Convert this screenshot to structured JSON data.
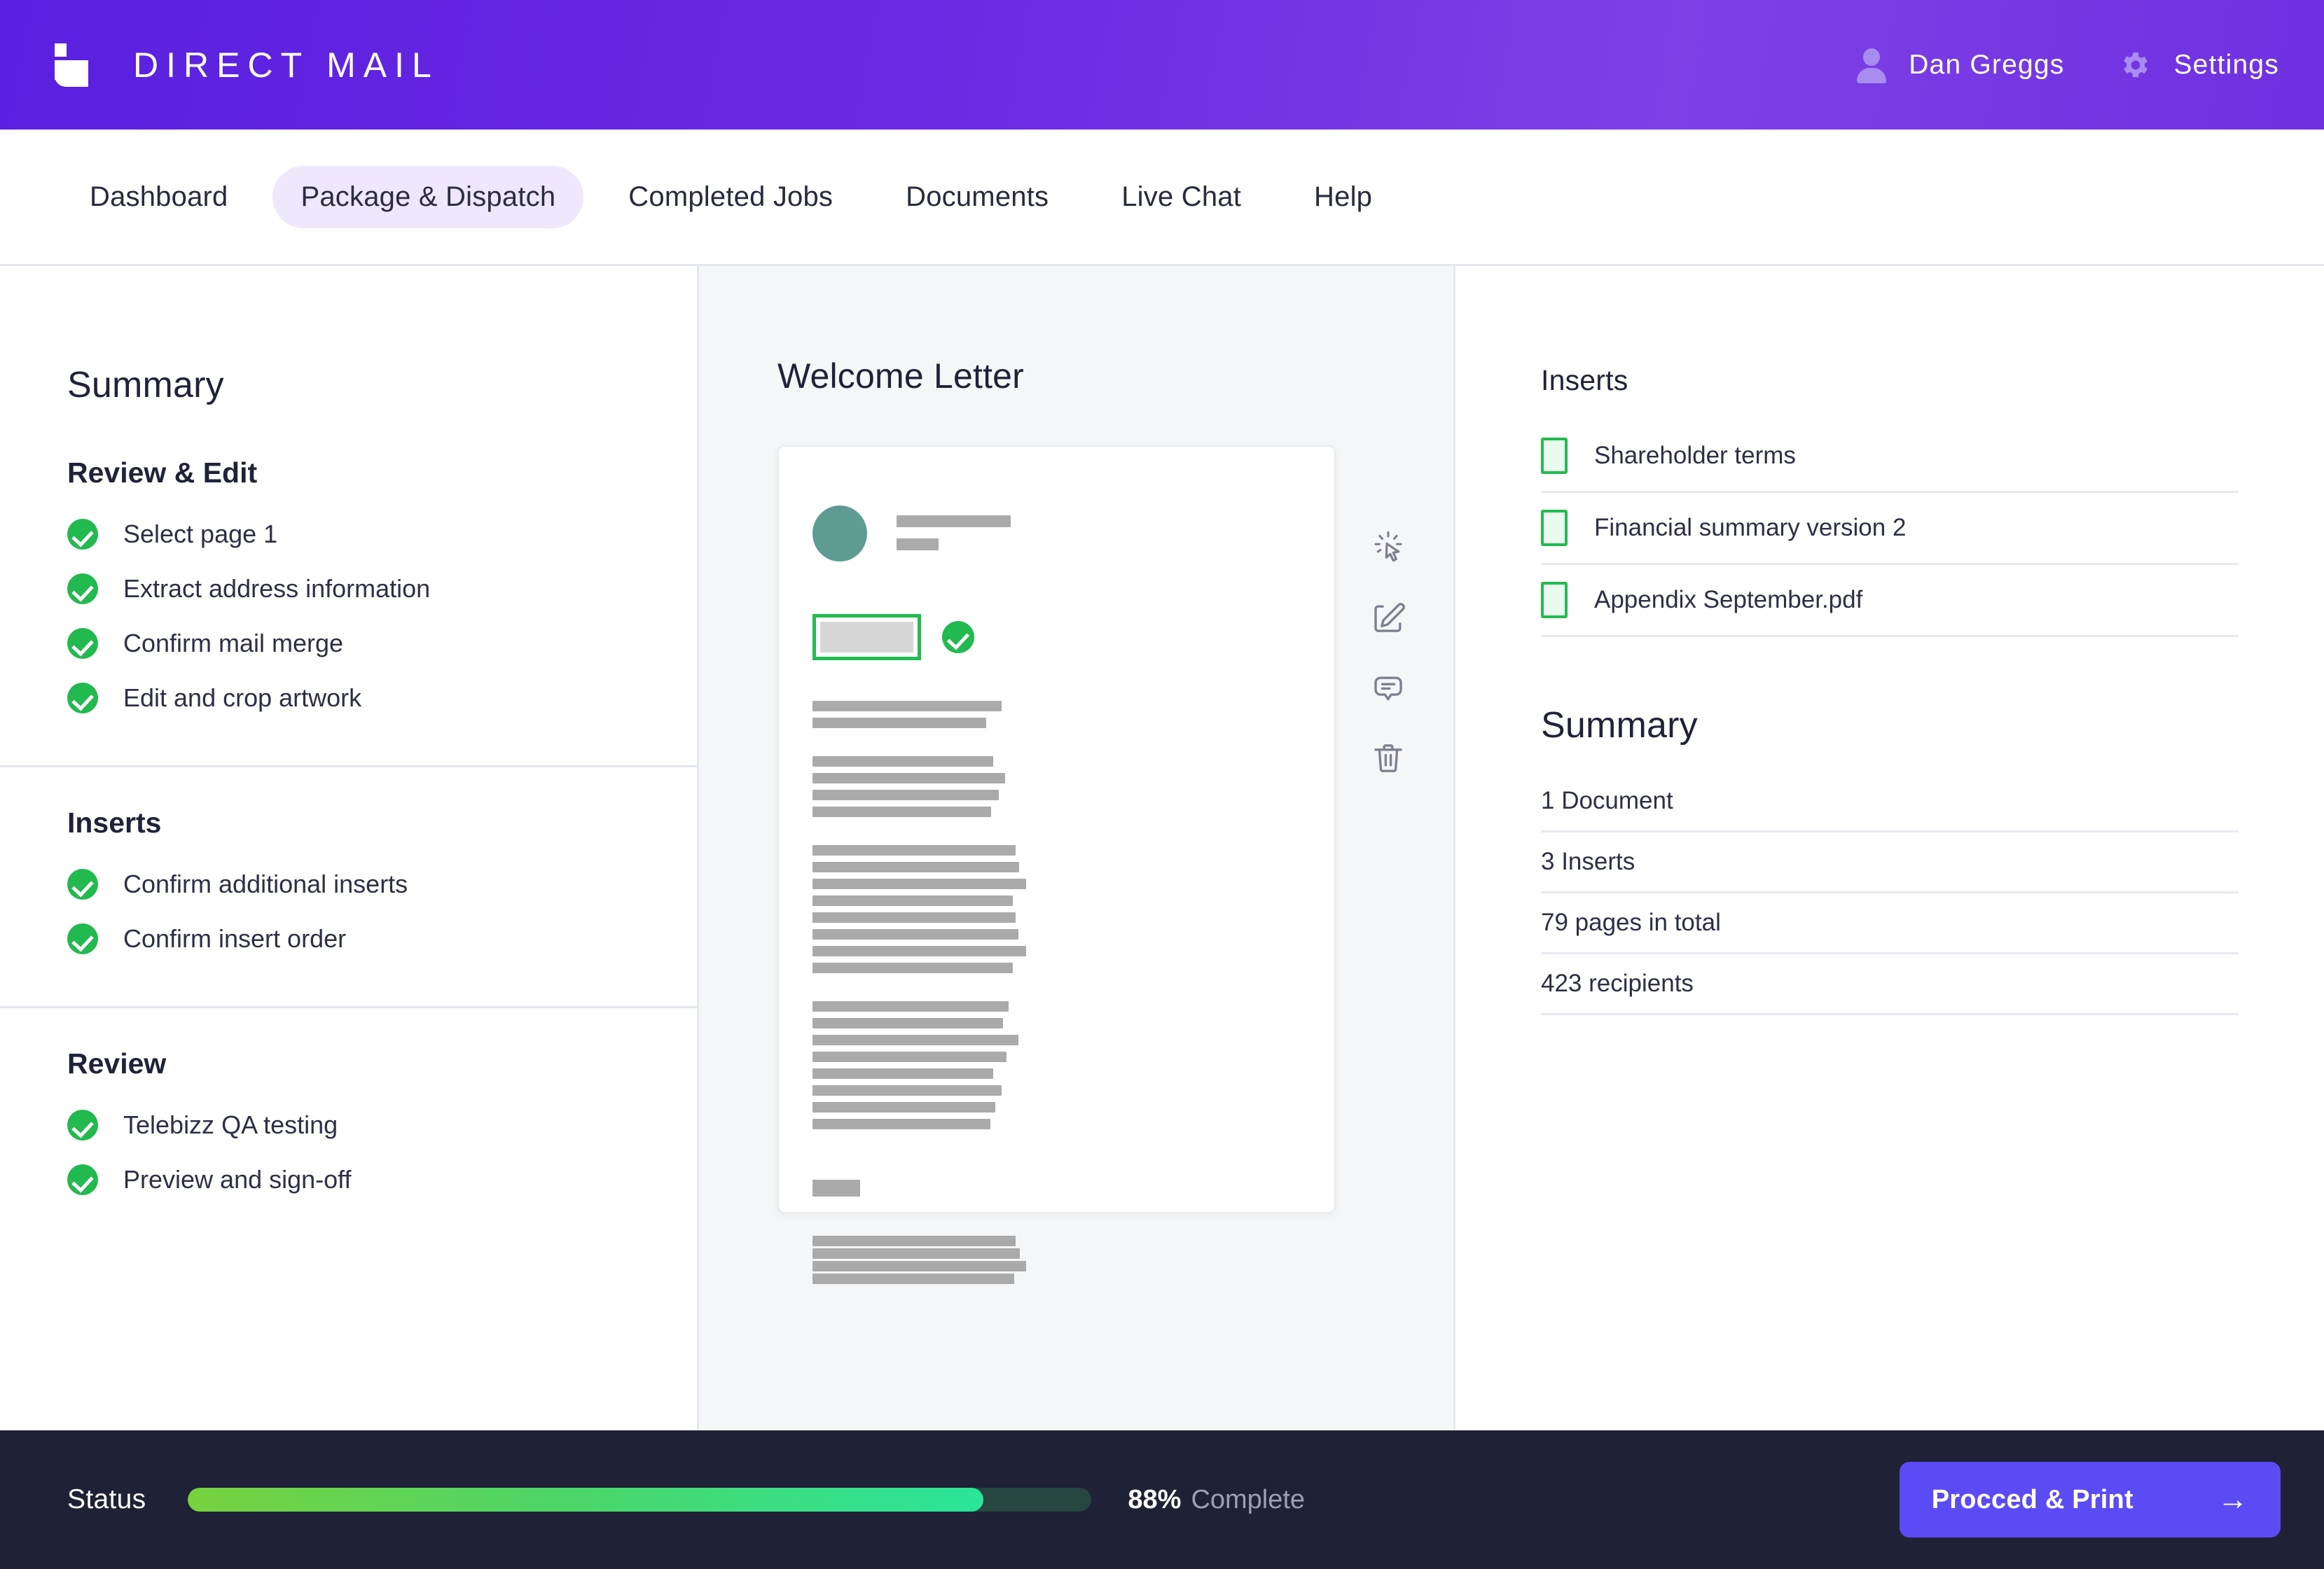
{
  "header": {
    "logo_icon": "telebizz-t-logo-icon",
    "brand_title": "DIRECT MAIL",
    "user_icon": "user-icon",
    "user_name": "Dan Greggs",
    "gear_icon": "gear-icon",
    "settings_label": "Settings",
    "gradient_from": "#5a1fe0",
    "gradient_to": "#7d41e6"
  },
  "nav": {
    "items": [
      {
        "label": "Dashboard",
        "active": false
      },
      {
        "label": "Package & Dispatch",
        "active": true
      },
      {
        "label": "Completed Jobs",
        "active": false
      },
      {
        "label": "Documents",
        "active": false
      },
      {
        "label": "Live Chat",
        "active": false
      },
      {
        "label": "Help",
        "active": false
      }
    ],
    "active_pill_color": "#efe7fb"
  },
  "sidebar": {
    "title": "Summary",
    "sections": [
      {
        "heading": "Review & Edit",
        "items": [
          {
            "label": "Select page 1",
            "status": "complete"
          },
          {
            "label": "Extract address information",
            "status": "complete"
          },
          {
            "label": "Confirm mail merge",
            "status": "complete"
          },
          {
            "label": "Edit and crop artwork",
            "status": "complete"
          }
        ]
      },
      {
        "heading": "Inserts",
        "items": [
          {
            "label": "Confirm additional inserts",
            "status": "complete"
          },
          {
            "label": "Confirm insert order",
            "status": "complete"
          }
        ]
      },
      {
        "heading": "Review",
        "items": [
          {
            "label": "Telebizz QA testing",
            "status": "complete"
          },
          {
            "label": "Preview and sign-off",
            "status": "complete"
          }
        ]
      }
    ],
    "check_color": "#22b94e"
  },
  "center": {
    "title": "Welcome Letter",
    "document_preview": {
      "avatar_color": "#5d9b93",
      "placeholder_color": "#aaaaaa",
      "address_block_border": "#22bb4f",
      "address_block_verified": true,
      "header_bar_widths": [
        163,
        60
      ],
      "paragraphs": [
        {
          "bar_widths": [
            270,
            248
          ],
          "gap_after": 40
        },
        {
          "bar_widths": [
            258,
            275,
            266,
            255
          ],
          "gap_after": 40
        },
        {
          "bar_widths": [
            290,
            295,
            305,
            286,
            290,
            294,
            305,
            286
          ],
          "gap_after": 40
        },
        {
          "bar_widths": [
            280,
            272,
            294,
            277,
            258,
            270,
            261,
            254
          ],
          "gap_after": 72
        },
        {
          "bar_widths": [
            290,
            296,
            305,
            288
          ],
          "gap_after": 60
        }
      ],
      "signature_block_width": 68,
      "footer_bar_widths": [
        290,
        296,
        305,
        288
      ]
    },
    "toolbar": [
      {
        "icon": "select-click-icon",
        "name": "select-tool"
      },
      {
        "icon": "edit-pencil-icon",
        "name": "edit-tool"
      },
      {
        "icon": "comment-icon",
        "name": "comment-tool"
      },
      {
        "icon": "trash-icon",
        "name": "delete-tool"
      }
    ]
  },
  "right_panel": {
    "inserts_title": "Inserts",
    "inserts": [
      {
        "label": "Shareholder terms",
        "icon": "document-icon"
      },
      {
        "label": "Financial summary version 2",
        "icon": "document-icon"
      },
      {
        "label": "Appendix September.pdf",
        "icon": "document-icon"
      }
    ],
    "summary_title": "Summary",
    "summary_rows": [
      "1 Document",
      "3 Inserts",
      "79 pages in total",
      "423 recipients"
    ]
  },
  "status_bar": {
    "label": "Status",
    "progress_percent": 88,
    "progress_value_text": "88%",
    "progress_suffix_text": "Complete",
    "progress_gradient_from": "#78d23f",
    "progress_gradient_to": "#2ae49a",
    "track_color": "#26463f",
    "background": "#1f2136",
    "proceed_button": {
      "label": "Procced & Print",
      "arrow_icon": "arrow-right-icon",
      "color": "#5b4bf5"
    }
  }
}
